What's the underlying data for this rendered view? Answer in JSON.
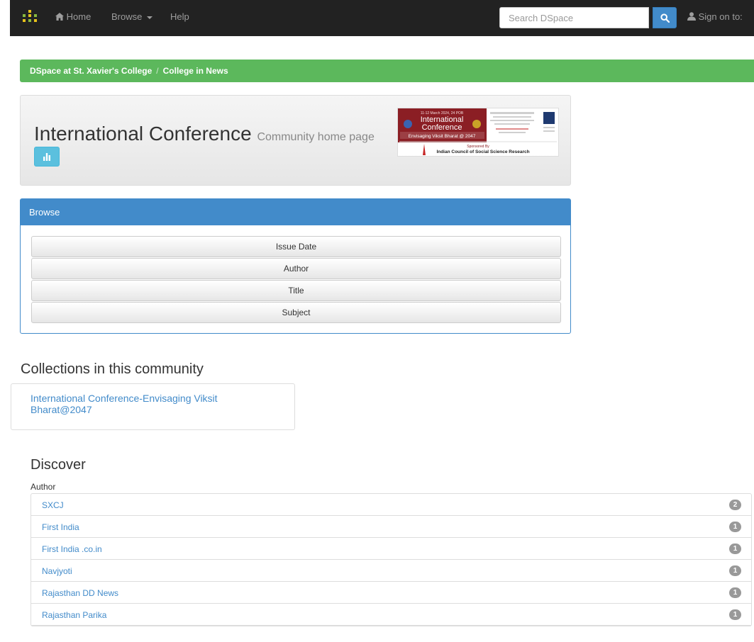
{
  "navbar": {
    "home_label": "Home",
    "browse_label": "Browse",
    "help_label": "Help",
    "search_placeholder": "Search DSpace",
    "signon_label": "Sign on to:"
  },
  "breadcrumb": {
    "items": [
      "DSpace at St. Xavier's College",
      "College in News"
    ],
    "separator": "/"
  },
  "community": {
    "title": "International Conference",
    "subtitle": "Community home page",
    "stats_icon": "bar-chart-icon",
    "logo_texts": {
      "date": "11-12 March 2024, 24 POB",
      "line1": "International",
      "line2": "Conference",
      "theme": "Envisaging Viksit Bharat @ 2047",
      "sponsored": "Sponsored By",
      "sponsor": "Indian Council of Social Science Research"
    }
  },
  "browse": {
    "heading": "Browse",
    "buttons": [
      "Issue Date",
      "Author",
      "Title",
      "Subject"
    ]
  },
  "collections": {
    "heading": "Collections in this community",
    "items": [
      "International Conference-Envisaging Viksit Bharat@2047"
    ]
  },
  "discover": {
    "heading": "Discover",
    "facet_label": "Author",
    "items": [
      {
        "name": "SXCJ",
        "count": "2"
      },
      {
        "name": "First India",
        "count": "1"
      },
      {
        "name": "First India .co.in",
        "count": "1"
      },
      {
        "name": "Navjyoti",
        "count": "1"
      },
      {
        "name": "Rajasthan DD News",
        "count": "1"
      },
      {
        "name": "Rajasthan Parika",
        "count": "1"
      }
    ]
  },
  "colors": {
    "navbar": "#222222",
    "breadcrumb": "#5cb85c",
    "primary": "#428bca",
    "info": "#5bc0de"
  }
}
